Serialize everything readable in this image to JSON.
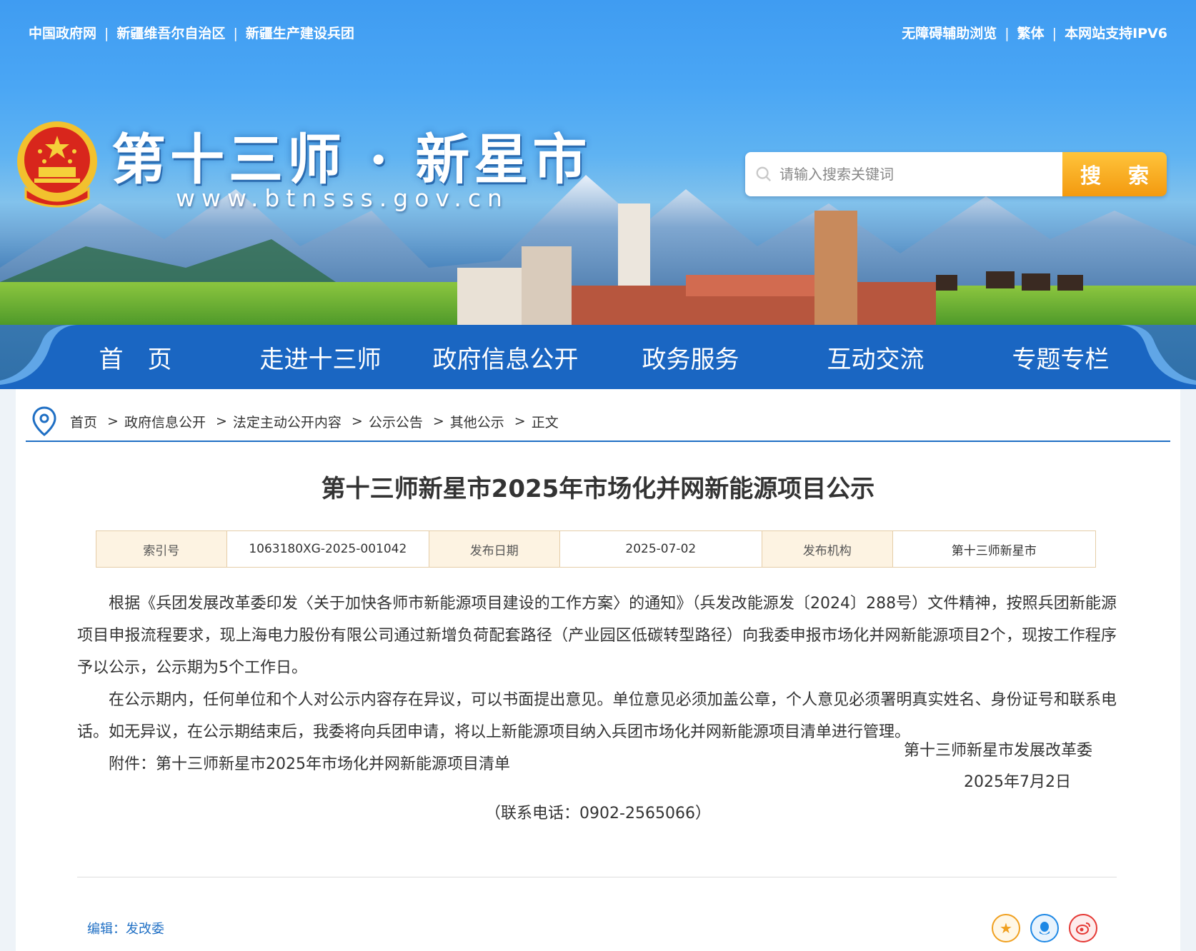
{
  "topbar": {
    "left_links": [
      "中国政府网",
      "新疆维吾尔自治区",
      "新疆生产建设兵团"
    ],
    "right_links": [
      "无障碍辅助浏览",
      "繁体",
      "本网站支持IPV6"
    ],
    "separator": "|"
  },
  "header": {
    "site_title": "第十三师 · 新星市",
    "site_url": "www.btnsss.gov.cn",
    "emblem_icon": "national-emblem-icon"
  },
  "search": {
    "placeholder": "请输入搜索关键词",
    "button_label": "搜 索",
    "icon": "search-icon"
  },
  "nav": {
    "items": [
      "首　页",
      "走进十三师",
      "政府信息公开",
      "政务服务",
      "互动交流",
      "专题专栏"
    ]
  },
  "breadcrumb": {
    "icon": "location-pin-icon",
    "items": [
      "首页",
      "政府信息公开",
      "法定主动公开内容",
      "公示公告",
      "其他公示",
      "正文"
    ],
    "separator": ">"
  },
  "article": {
    "title": "第十三师新星市2025年市场化并网新能源项目公示",
    "meta": {
      "index_label": "索引号",
      "index_value": "1063180XG-2025-001042",
      "date_label": "发布日期",
      "date_value": "2025-07-02",
      "org_label": "发布机构",
      "org_value": "第十三师新星市"
    },
    "paragraphs": [
      "根据《兵团发展改革委印发〈关于加快各师市新能源项目建设的工作方案〉的通知》（兵发改能源发〔2024〕288号）文件精神，按照兵团新能源项目申报流程要求，现上海电力股份有限公司通过新增负荷配套路径（产业园区低碳转型路径）向我委申报市场化并网新能源项目2个，现按工作程序予以公示，公示期为5个工作日。",
      "在公示期内，任何单位和个人对公示内容存在异议，可以书面提出意见。单位意见必须加盖公章，个人意见必须署明真实姓名、身份证号和联系电话。如无异议，在公示期结束后，我委将向兵团申请，将以上新能源项目纳入兵团市场化并网新能源项目清单进行管理。"
    ],
    "attachment_label": "附件：",
    "attachment_link": "第十三师新星市2025年市场化并网新能源项目清单",
    "sign_org": "第十三师新星市发展改革委",
    "sign_date": "2025年7月2日",
    "contact": "（联系电话：0902-2565066）",
    "editor": "编辑：发改委"
  },
  "share": {
    "icons": [
      "favorite-star-icon",
      "qq-icon",
      "weibo-icon"
    ],
    "colors": [
      "#f0a020",
      "#1e88e5",
      "#e53935"
    ]
  }
}
